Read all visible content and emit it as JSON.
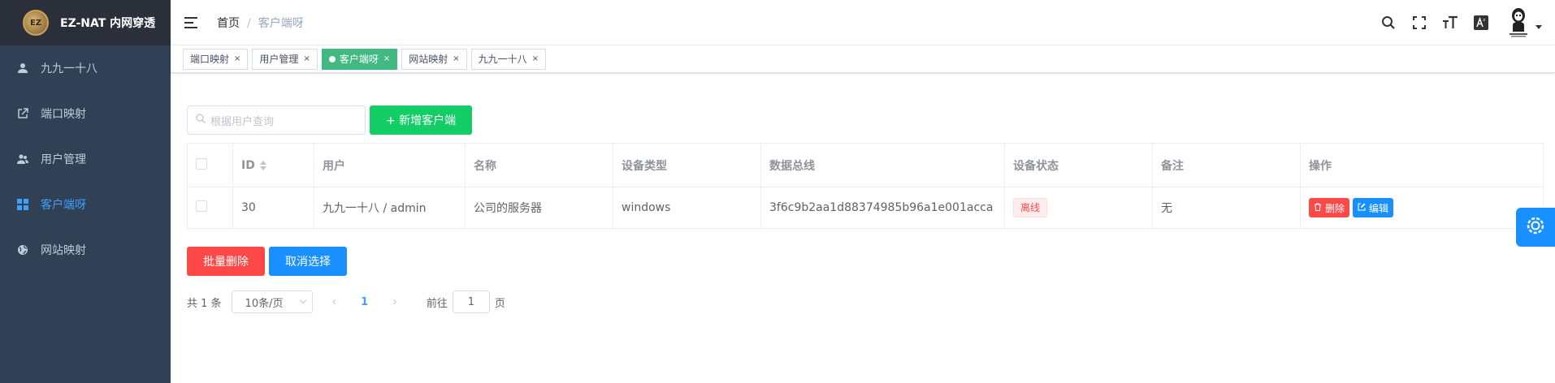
{
  "app": {
    "title": "EZ-NAT 内网穿透",
    "logo_text": "EZ"
  },
  "sidebar": {
    "items": [
      {
        "label": "九九一十八",
        "icon": "user-icon"
      },
      {
        "label": "端口映射",
        "icon": "external-link-icon"
      },
      {
        "label": "用户管理",
        "icon": "users-icon"
      },
      {
        "label": "客户端呀",
        "icon": "grid-icon",
        "active": true
      },
      {
        "label": "网站映射",
        "icon": "globe-icon"
      }
    ]
  },
  "header": {
    "breadcrumb": {
      "home": "首页",
      "separator": "/",
      "current": "客户端呀"
    },
    "icons": [
      "search-icon",
      "fullscreen-icon",
      "font-size-icon",
      "language-icon"
    ]
  },
  "tags": [
    {
      "label": "端口映射",
      "close": "×"
    },
    {
      "label": "用户管理",
      "close": "×"
    },
    {
      "label": "客户端呀",
      "close": "×",
      "active": true
    },
    {
      "label": "网站映射",
      "close": "×"
    },
    {
      "label": "九九一十八",
      "close": "×"
    }
  ],
  "toolbar": {
    "search_placeholder": "根据用户查询",
    "add_label": "+ 新增客户端"
  },
  "table": {
    "columns": [
      "ID",
      "用户",
      "名称",
      "设备类型",
      "数据总线",
      "设备状态",
      "备注",
      "操作"
    ],
    "rows": [
      {
        "id": "30",
        "user": "九九一十八 / admin",
        "name": "公司的服务器",
        "device_type": "windows",
        "bus": "3f6c9b2aa1d88374985b96a1e001acca",
        "status": "离线",
        "remark": "无",
        "delete_label": "删除",
        "edit_label": "编辑"
      }
    ]
  },
  "bulk": {
    "delete_label": "批量删除",
    "cancel_label": "取消选择"
  },
  "pagination": {
    "total_text": "共 1 条",
    "page_size": "10条/页",
    "prev": "‹",
    "current": "1",
    "next": "›",
    "goto_label": "前往",
    "goto_value": "1",
    "page_suffix": "页"
  },
  "colors": {
    "sidebar_bg": "#304156",
    "active": "#409eff",
    "add_button": "#13ce66",
    "danger": "#ff4949",
    "primary": "#1890ff",
    "tag_active": "#42b983"
  }
}
